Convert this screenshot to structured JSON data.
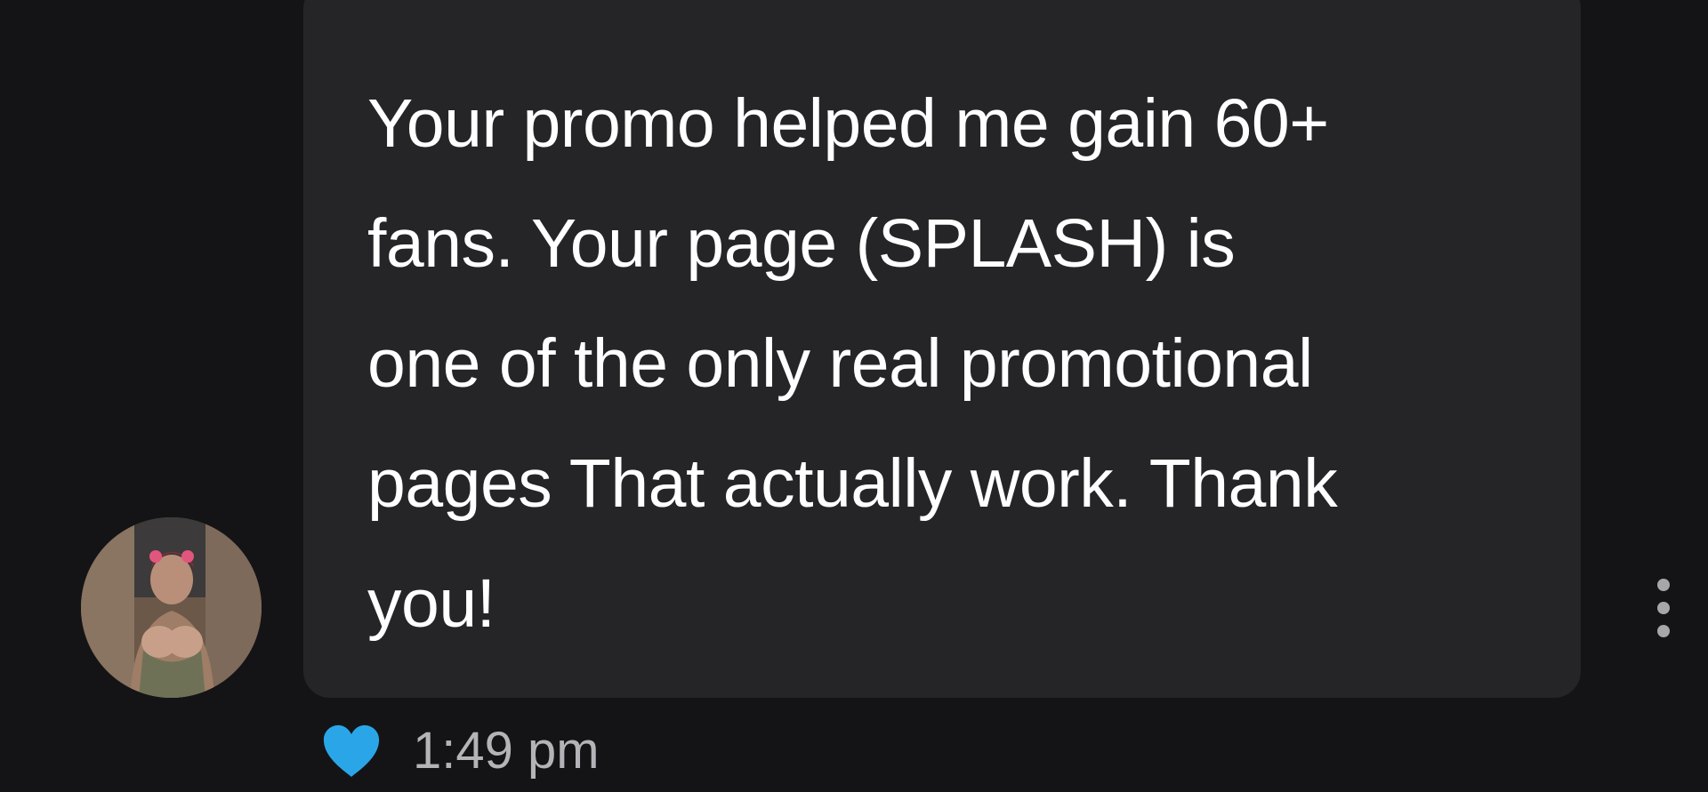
{
  "message": {
    "text": "Your promo helped me gain 60+\nfans. Your page (SPLASH) is\none of the only real promotional\npages That actually work. Thank\nyou!",
    "timestamp": "1:49 pm",
    "liked": true
  },
  "icons": {
    "like": "heart-icon",
    "more": "more-options-icon"
  },
  "colors": {
    "background": "#141416",
    "bubble": "#252528",
    "text": "#ffffff",
    "timestamp": "#b4b4b8",
    "heart": "#2aa6e8",
    "more_dots": "#a7a7ab"
  }
}
